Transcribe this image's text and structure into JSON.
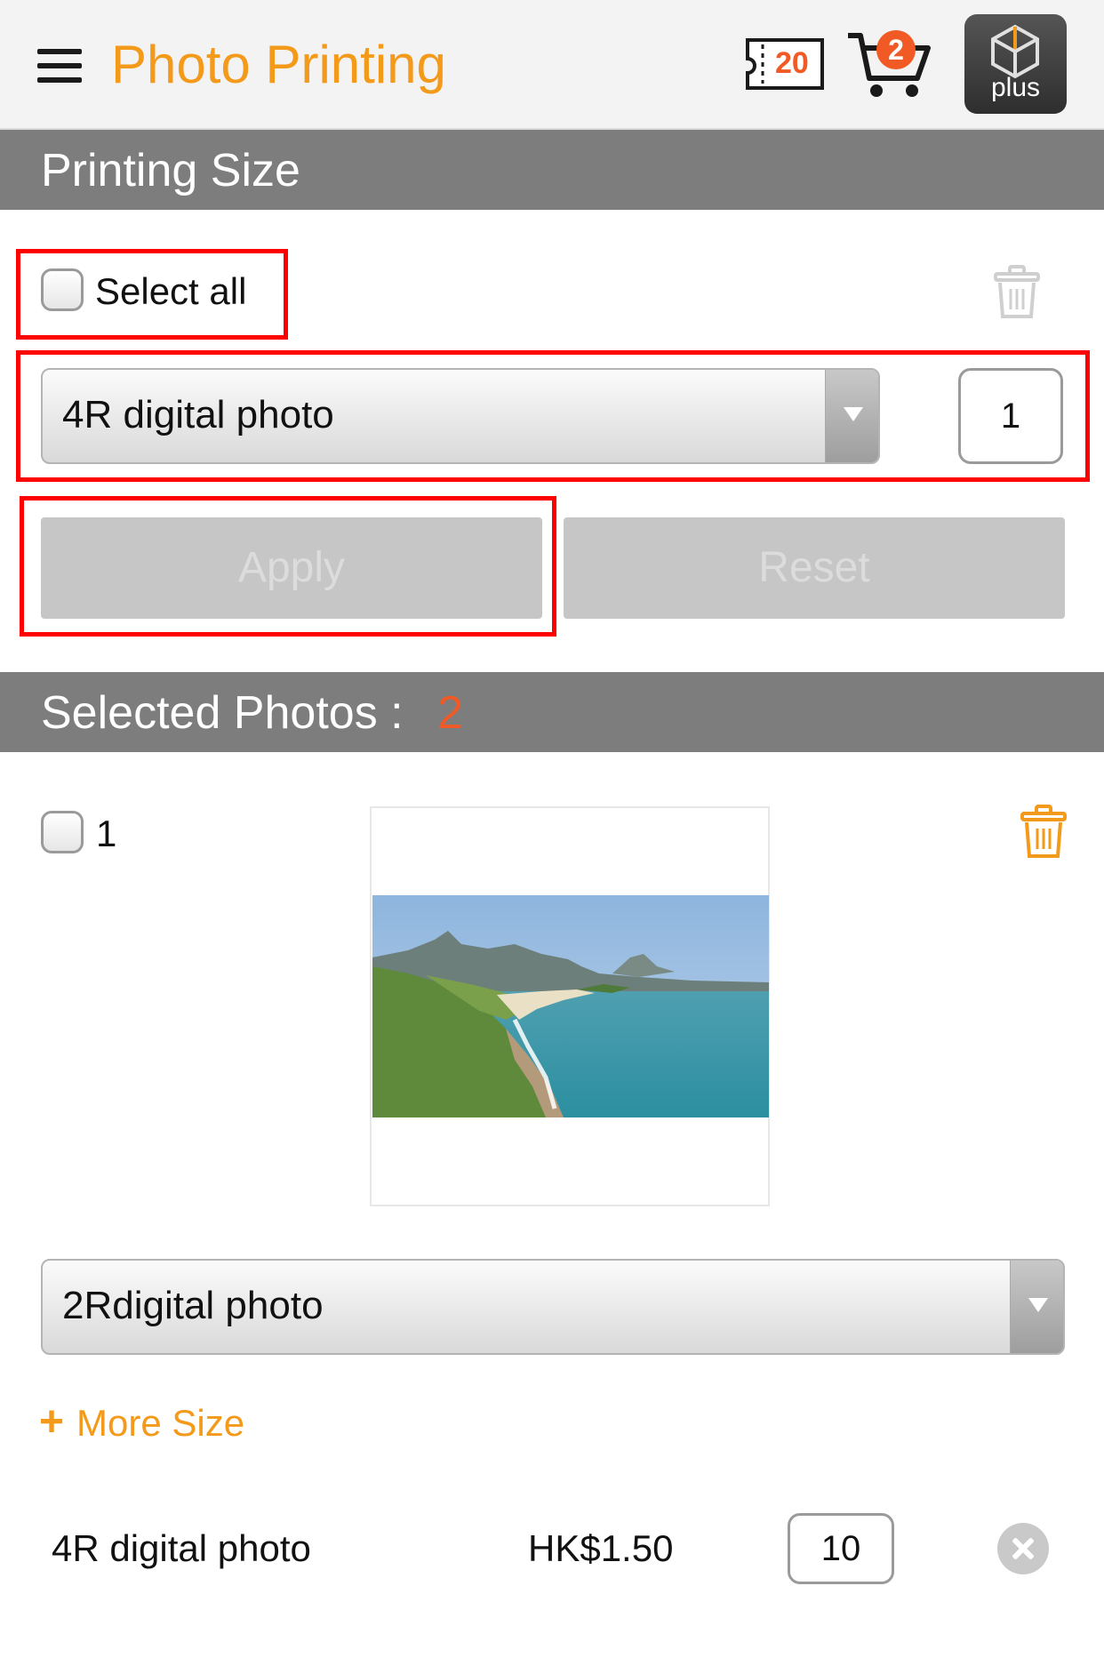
{
  "header": {
    "title": "Photo Printing",
    "coupon_count": "20",
    "cart_badge": "2",
    "plus_label": "plus",
    "colors": {
      "accent": "#f39a1a",
      "badge": "#f15a24",
      "bar": "#7d7d7d"
    }
  },
  "printing_size": {
    "section_title": "Printing Size",
    "select_all_label": "Select all",
    "size_dropdown_value": "4R digital photo",
    "quantity_value": "1",
    "apply_label": "Apply",
    "reset_label": "Reset"
  },
  "selected_photos": {
    "section_title": "Selected Photos :",
    "count": "2",
    "items": [
      {
        "index": "1",
        "size_dropdown_value": "2Rdigital photo",
        "more_size_label": "More Size",
        "line": {
          "size": "4R digital photo",
          "price": "HK$1.50",
          "quantity": "10"
        }
      }
    ]
  },
  "icons": [
    "menu-icon",
    "coupon-icon",
    "cart-icon",
    "plus-logo-icon",
    "trash-icon",
    "close-icon",
    "plus-icon"
  ]
}
